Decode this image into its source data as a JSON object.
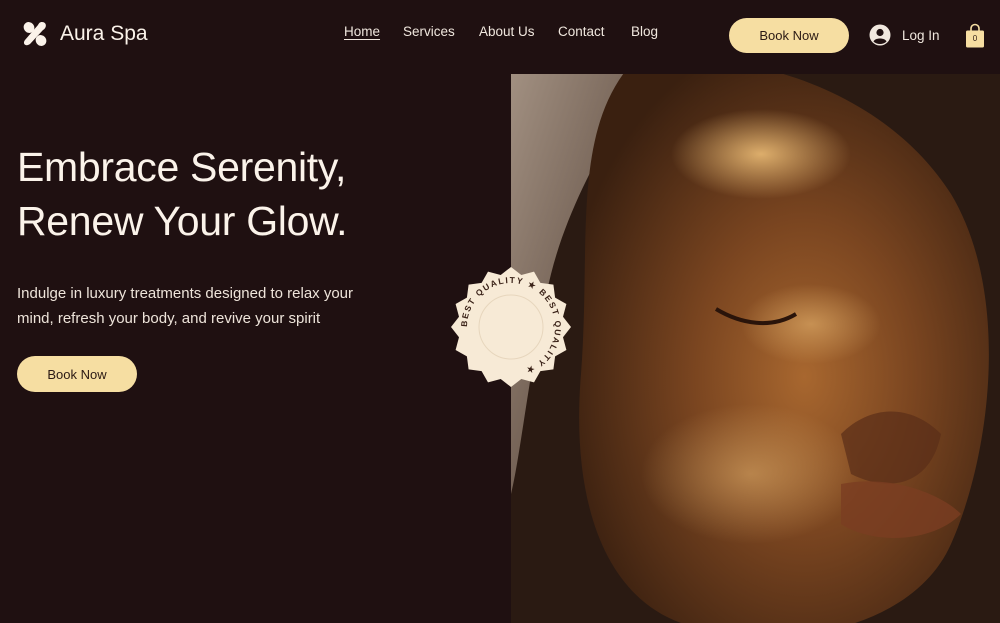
{
  "brand": {
    "name": "Aura Spa",
    "icon": "aura-logo-icon"
  },
  "nav": {
    "items": [
      {
        "label": "Home",
        "active": true
      },
      {
        "label": "Services",
        "active": false
      },
      {
        "label": "About Us",
        "active": false
      },
      {
        "label": "Contact",
        "active": false
      },
      {
        "label": "Blog",
        "active": false
      }
    ]
  },
  "header": {
    "book_label": "Book Now",
    "login_label": "Log In",
    "cart_count": "0"
  },
  "hero": {
    "title_line1": "Embrace Serenity,",
    "title_line2": "Renew Your Glow.",
    "subtitle_line1": "Indulge in luxury treatments designed to relax your",
    "subtitle_line2": "mind, refresh your body, and revive your spirit",
    "book_label": "Book Now"
  },
  "badge": {
    "text": "BEST QUALITY ★ BEST QUALITY ★"
  },
  "colors": {
    "background": "#1f1011",
    "accent": "#f6dea2",
    "text": "#fbf3ea"
  }
}
